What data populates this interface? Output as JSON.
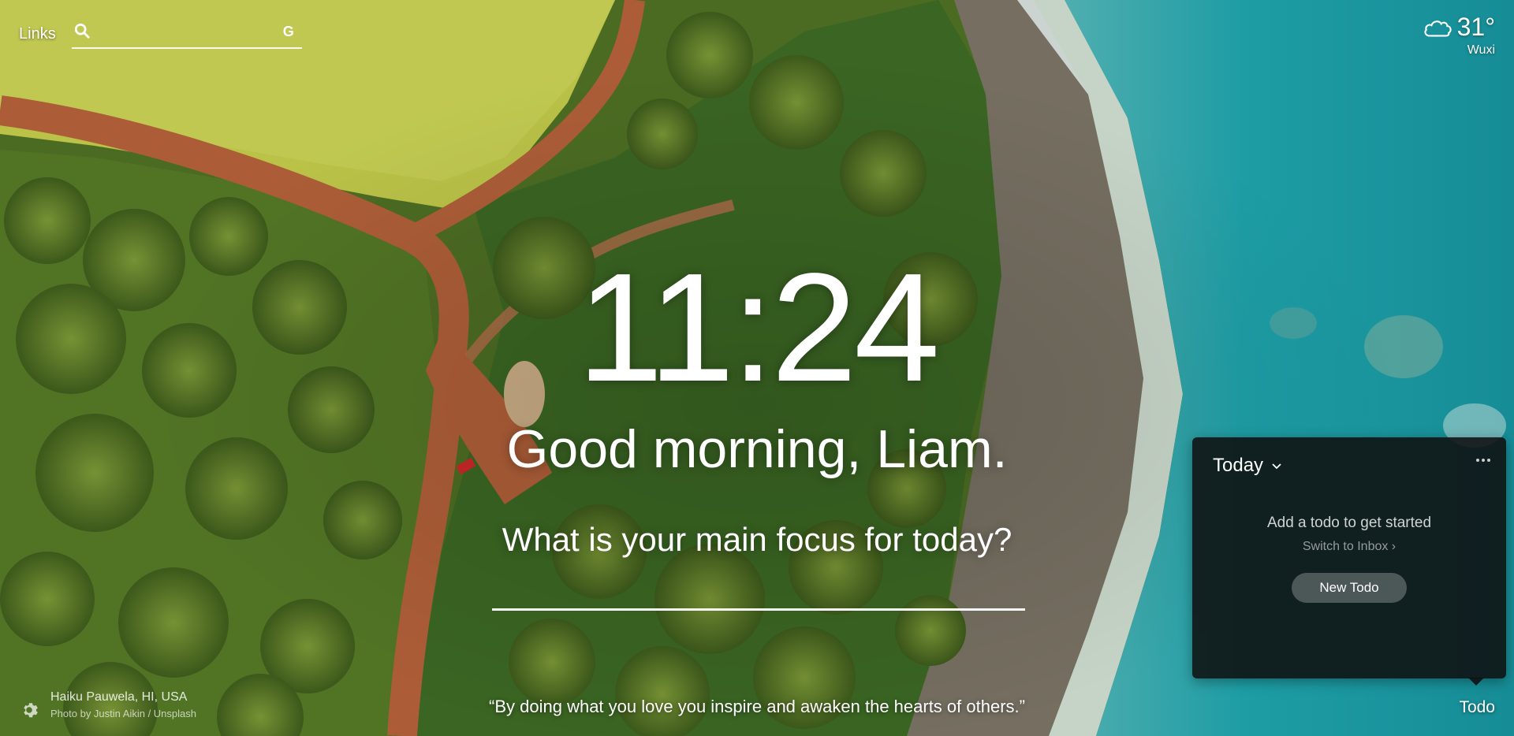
{
  "colors": {
    "forest": "#5b7a2a",
    "meadow": "#c6cf4a",
    "road": "#b5623a",
    "sea": "#1fa5ad",
    "rocks": "#6f6a60",
    "panel": "#0f0f0f"
  },
  "top_left": {
    "links_label": "Links",
    "search_placeholder": "",
    "search_icon": "search-icon",
    "engine_icon": "google-icon",
    "engine_glyph": "G"
  },
  "weather": {
    "icon": "cloud-icon",
    "temperature": "31°",
    "city": "Wuxi"
  },
  "clock": {
    "time": "11:24"
  },
  "greeting": {
    "text": "Good morning, Liam."
  },
  "focus": {
    "question": "What is your main focus for today?",
    "value": ""
  },
  "quote": {
    "text": "“By doing what you love you inspire and awaken the hearts of others.”"
  },
  "photo_info": {
    "location": "Haiku Pauwela, HI, USA",
    "credit": "Photo by Justin Aikin / Unsplash",
    "settings_icon": "gear-icon"
  },
  "todo": {
    "list_name": "Today",
    "empty_message": "Add a todo to get started",
    "switch_label": "Switch to Inbox ›",
    "new_button": "New Todo",
    "toggle_label": "Todo",
    "menu_icon": "more-icon"
  }
}
